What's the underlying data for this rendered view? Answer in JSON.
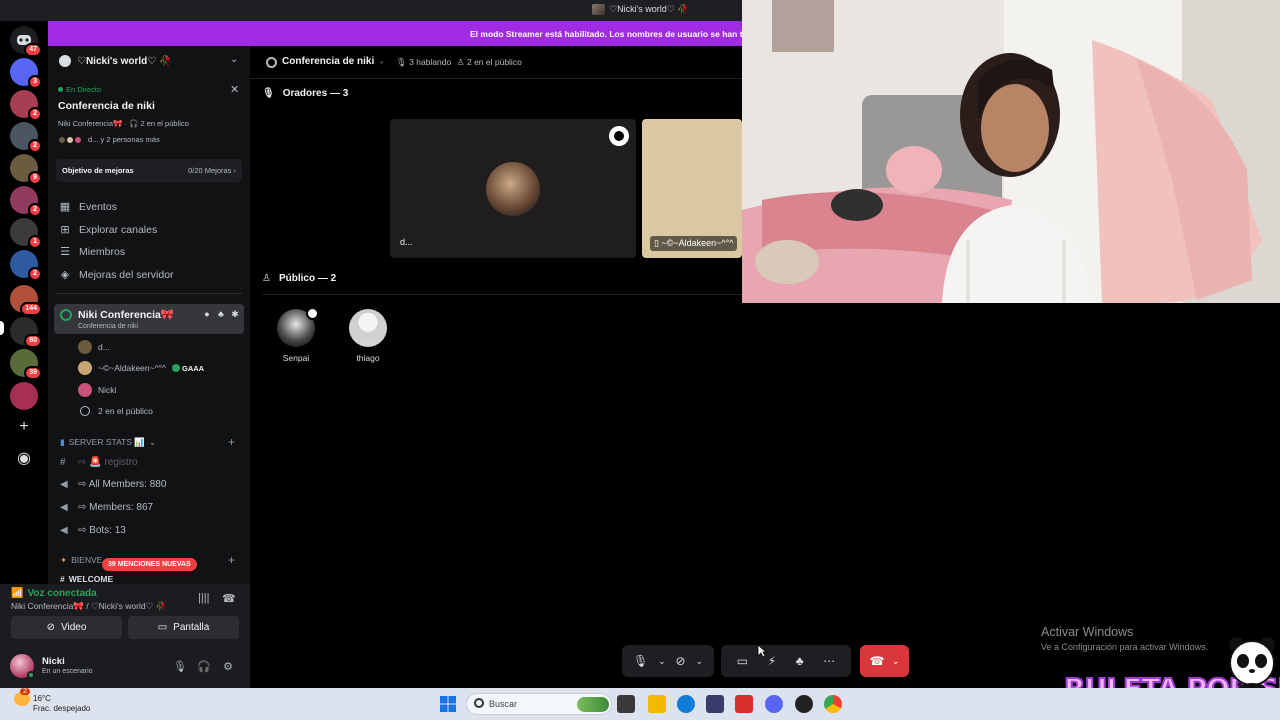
{
  "titlebar": {
    "server_name": "♡Nicki's world♡ 🥀"
  },
  "banner": {
    "text": "El modo Streamer está habilitado. Los nombres de usuario se han tr"
  },
  "rail": {
    "top_badge": "47",
    "servers": [
      {
        "badge": "3",
        "color": "#5865f2"
      },
      {
        "badge": "2",
        "color": "#a63d52"
      },
      {
        "badge": "2",
        "color": "#4a5561"
      },
      {
        "badge": "9",
        "color": "#6b5b3f"
      },
      {
        "badge": "2",
        "color": "#8e3b5d"
      },
      {
        "badge": "1",
        "color": "#3b3b3b"
      },
      {
        "badge": "2",
        "color": "#2d5aa0"
      },
      {
        "badge": "144",
        "color": "#b0503a"
      },
      {
        "badge": "80",
        "color": "#2b2b2b"
      },
      {
        "badge": "39",
        "color": "#5a6b3a"
      },
      {
        "badge": "",
        "color": "#a82f54"
      }
    ]
  },
  "sidebar": {
    "server_name": "♡Nicki's world♡ 🥀",
    "stage": {
      "live_label": "En Directo",
      "title": "Conferencia de niki",
      "meta": "Niki Conferencia🎀 · 🎧 2 en el público",
      "more": "d... y 2 personas más"
    },
    "goal": {
      "label": "Objetivo de mejoras",
      "value": "0/20 Mejoras ›"
    },
    "nav": [
      {
        "label": "Eventos",
        "icon": "calendar-icon"
      },
      {
        "label": "Explorar canales",
        "icon": "compass-icon"
      },
      {
        "label": "Miembros",
        "icon": "members-icon"
      },
      {
        "label": "Mejoras del servidor",
        "icon": "boost-icon"
      }
    ],
    "active_channel": {
      "name": "Niki Conferencia🎀",
      "sub": "Conferencia de niki"
    },
    "members": [
      {
        "name": "d..."
      },
      {
        "name": "~©~Aldakeen~^°^",
        "tag": "GAAA"
      },
      {
        "name": "Nicki"
      },
      {
        "name": "2 en el público"
      }
    ],
    "category_stats": "SERVER STATS 📊",
    "stat_channels": [
      "⇨ 🚨 registro",
      "⇨ All Members: 880",
      "⇨ Members: 867",
      "⇨ Bots: 13"
    ],
    "category_bienv": "BIENVE",
    "welcome_fragment": "WELCOME",
    "mentions": "39 MENCIONES NUEVAS"
  },
  "voice": {
    "status": "Voz conectada",
    "location": "Niki Conferencia🎀 / ♡Nicki's world♡ 🥀",
    "video_label": "Video",
    "screen_label": "Pantalla"
  },
  "user": {
    "name": "Nicki",
    "status": "En un escenario"
  },
  "main": {
    "channel_title": "Conferencia de niki",
    "speaking": "3 hablando",
    "audience_count": "2 en el público",
    "speakers_label": "Oradores — 3",
    "audience_label": "Público — 2",
    "speakers": [
      {
        "name": "d..."
      },
      {
        "name": "~©~Aldakeen~^°^"
      }
    ],
    "audience": [
      {
        "name": "Senpai"
      },
      {
        "name": "thiago"
      }
    ]
  },
  "overlay": {
    "activate_title": "Activar Windows",
    "activate_sub": "Ve a Configuración para activar Windows.",
    "ruleta": "RULETA POR SUB"
  },
  "taskbar": {
    "weather_temp": "16°C",
    "weather_desc": "Frac. despejado",
    "weather_badge": "2",
    "search_placeholder": "Buscar"
  }
}
